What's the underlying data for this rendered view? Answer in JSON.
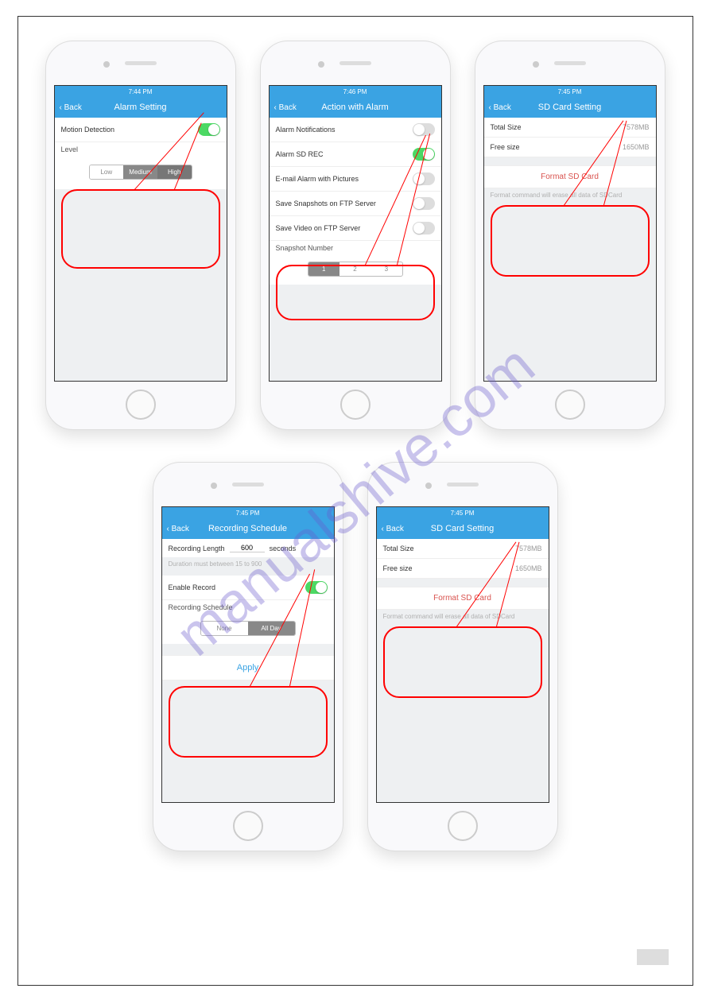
{
  "watermark": "manualshive.com",
  "status_time": {
    "p1": "7:44 PM",
    "p2": "7:46 PM",
    "p3": "7:45 PM",
    "p4": "7:45 PM",
    "p5": "7:45 PM"
  },
  "nav": {
    "back": "Back",
    "alarm_setting": "Alarm Setting",
    "action_alarm": "Action with Alarm",
    "sd_card": "SD Card Setting",
    "rec_schedule": "Recording Schedule"
  },
  "alarm_setting": {
    "motion_detection": "Motion Detection",
    "level": "Level",
    "levels": [
      "Low",
      "Medium",
      "High"
    ]
  },
  "action_alarm": {
    "items": [
      "Alarm Notifications",
      "Alarm SD REC",
      "E-mail Alarm with Pictures",
      "Save Snapshots on FTP Server",
      "Save Video on FTP Server"
    ],
    "snapshot_label": "Snapshot Number",
    "snapshot_opts": [
      "1",
      "2",
      "3"
    ]
  },
  "sd_card": {
    "total_label": "Total Size",
    "total_value": "7578MB",
    "free_label": "Free size",
    "free_value": "1650MB",
    "format_label": "Format SD Card",
    "format_hint": "Format command will erase all data of SDCard"
  },
  "rec_schedule": {
    "length_label": "Recording Length",
    "length_value": "600",
    "length_unit": "seconds",
    "length_hint": "Duration must between 15 to 900",
    "enable_label": "Enable Record",
    "schedule_label": "Recording Schedule",
    "schedule_opts": [
      "None",
      "All Day"
    ],
    "apply": "Apply"
  }
}
